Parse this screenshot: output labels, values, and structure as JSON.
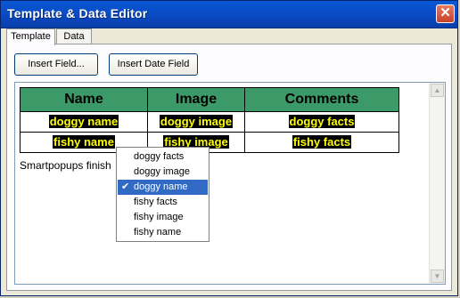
{
  "window": {
    "title": "Template & Data Editor"
  },
  "tabs": [
    {
      "label": "Template"
    },
    {
      "label": "Data"
    }
  ],
  "toolbar": {
    "insert_field": "Insert Field...",
    "insert_date_field": "Insert Date Field"
  },
  "table": {
    "headers": [
      "Name",
      "Image",
      "Comments"
    ],
    "rows": [
      [
        "doggy name",
        "doggy image",
        "doggy facts"
      ],
      [
        "fishy name",
        "fishy image",
        "fishy facts"
      ]
    ]
  },
  "note": "Smartpopups finish",
  "menu": {
    "items": [
      "doggy facts",
      "doggy image",
      "doggy name",
      "fishy facts",
      "fishy image",
      "fishy name"
    ],
    "selected_index": 2
  },
  "colors": {
    "header_bg": "#3c9968",
    "field_bg": "#000000",
    "field_fg": "#ffff00",
    "selection": "#316ac5"
  }
}
